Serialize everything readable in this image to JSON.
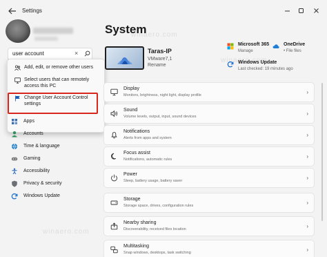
{
  "window": {
    "title": "Settings"
  },
  "search": {
    "value": "user account"
  },
  "results": [
    {
      "label": "Add, edit, or remove other users",
      "icon": "people-icon"
    },
    {
      "label": "Select users that can remotely access this PC",
      "icon": "remote-users-icon"
    },
    {
      "label": "Change User Account Control settings",
      "icon": "flag-icon"
    }
  ],
  "nav": [
    {
      "label": "Apps",
      "icon": "apps-icon"
    },
    {
      "label": "Accounts",
      "icon": "accounts-icon"
    },
    {
      "label": "Time & language",
      "icon": "globe-clock-icon"
    },
    {
      "label": "Gaming",
      "icon": "gamepad-icon"
    },
    {
      "label": "Accessibility",
      "icon": "accessibility-icon"
    },
    {
      "label": "Privacy & security",
      "icon": "shield-icon"
    },
    {
      "label": "Windows Update",
      "icon": "update-icon"
    }
  ],
  "page": {
    "title": "System"
  },
  "device": {
    "name": "Taras-IP",
    "model": "VMware7,1",
    "rename": "Rename"
  },
  "quick_status": [
    {
      "title": "Microsoft 365",
      "subtitle": "Manage",
      "icon": "microsoft-icon"
    },
    {
      "title": "OneDrive",
      "subtitle": "• File files",
      "icon": "cloud-icon"
    },
    {
      "title": "Windows Update",
      "subtitle": "Last checked: 19 minutes ago",
      "icon": "update-icon"
    }
  ],
  "cards": [
    {
      "title": "Display",
      "subtitle": "Monitors, brightness, night light, display profile",
      "icon": "display-icon"
    },
    {
      "title": "Sound",
      "subtitle": "Volume levels, output, input, sound devices",
      "icon": "speaker-icon"
    },
    {
      "title": "Notifications",
      "subtitle": "Alerts from apps and system",
      "icon": "bell-icon"
    },
    {
      "title": "Focus assist",
      "subtitle": "Notifications, automatic rules",
      "icon": "moon-icon"
    },
    {
      "title": "Power",
      "subtitle": "Sleep, battery usage, battery saver",
      "icon": "power-icon"
    },
    {
      "title": "Storage",
      "subtitle": "Storage space, drives, configuration rules",
      "icon": "storage-icon"
    },
    {
      "title": "Nearby sharing",
      "subtitle": "Discoverability, received files location",
      "icon": "share-icon"
    },
    {
      "title": "Multitasking",
      "subtitle": "Snap windows, desktops, task switching",
      "icon": "multitask-icon"
    }
  ],
  "watermark": "winaero.com",
  "colors": {
    "accent": "#1a5fb4",
    "highlight_border": "#d9261c"
  }
}
